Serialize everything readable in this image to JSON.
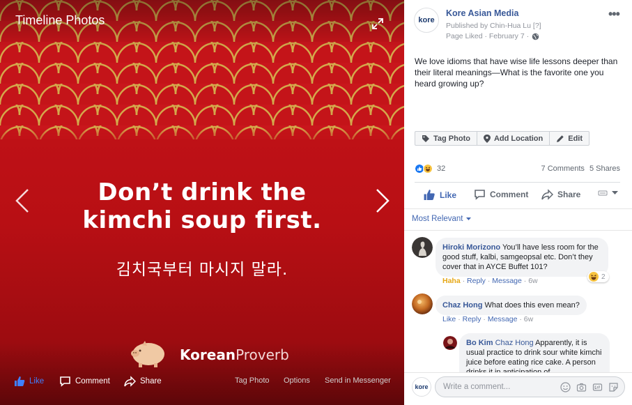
{
  "photo": {
    "title": "Timeline Photos",
    "headline_line1": "Don’t drink the",
    "headline_line2": "kimchi soup first.",
    "korean_text": "김치국부터 마시지 말라.",
    "brand_bold": "Korean",
    "brand_thin": "Proverb",
    "actions": {
      "like": "Like",
      "comment": "Comment",
      "share": "Share",
      "tag_photo": "Tag Photo",
      "options": "Options",
      "send": "Send in Messenger"
    }
  },
  "post": {
    "page_name": "Kore Asian Media",
    "avatar_text": "kore",
    "published_by": "Published by Chin-Hua Lu [?]",
    "meta_liked": "Page Liked",
    "meta_date": "February 7",
    "text": "We love idioms that have wise life lessons deeper than their literal meanings—What is the favorite one you heard growing up?",
    "edit_bar": {
      "tag_photo": "Tag Photo",
      "add_location": "Add Location",
      "edit": "Edit"
    },
    "reaction_count": "32",
    "comments_count": "7 Comments",
    "shares_count": "5 Shares",
    "actions": {
      "like": "Like",
      "comment": "Comment",
      "share": "Share"
    },
    "sort_label": "Most Relevant"
  },
  "comments": [
    {
      "author": "Hiroki Morizono",
      "text": "You’ll have less room for the good stuff, kalbi, samgeopsal etc. Don’t they cover that in AYCE Buffet 101?",
      "reaction_label": "Haha",
      "reply": "Reply",
      "message": "Message",
      "age": "6w",
      "reaction_count": "2"
    },
    {
      "author": "Chaz Hong",
      "text": "What does this even mean?",
      "like": "Like",
      "reply": "Reply",
      "message": "Message",
      "age": "6w"
    },
    {
      "author": "Bo Kim",
      "mention": "Chaz Hong",
      "text": "Apparently, it is usual practice to drink sour white kimchi juice before eating rice cake. A person drinks it in anticipation of"
    }
  ],
  "composer": {
    "avatar_text": "kore",
    "placeholder": "Write a comment..."
  },
  "colors": {
    "fb_blue": "#4267b2",
    "link": "#385898",
    "photo_red": "#c8141a",
    "gold": "#d4a84b"
  }
}
